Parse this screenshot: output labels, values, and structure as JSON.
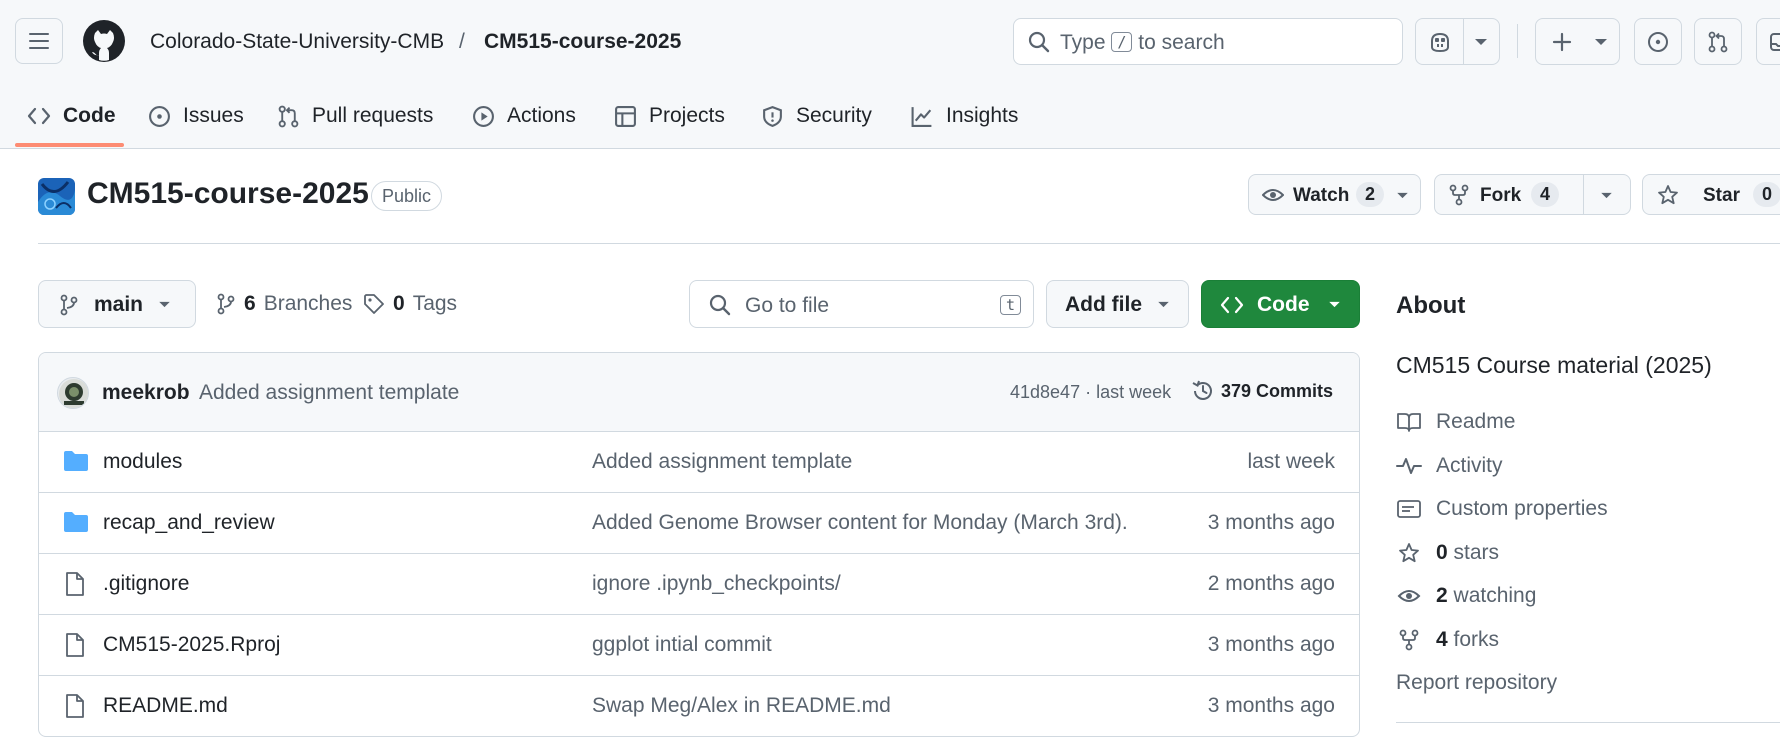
{
  "header": {
    "org": "Colorado-State-University-CMB",
    "separator": "/",
    "repo": "CM515-course-2025",
    "search": {
      "prefix": "Type",
      "key": "/",
      "suffix": "to search"
    }
  },
  "tabs": [
    {
      "label": "Code",
      "icon": "code-icon",
      "selected": true
    },
    {
      "label": "Issues",
      "icon": "issue-opened-icon"
    },
    {
      "label": "Pull requests",
      "icon": "git-pull-request-icon"
    },
    {
      "label": "Actions",
      "icon": "play-icon"
    },
    {
      "label": "Projects",
      "icon": "table-icon"
    },
    {
      "label": "Security",
      "icon": "shield-icon"
    },
    {
      "label": "Insights",
      "icon": "graph-icon"
    }
  ],
  "repo": {
    "title": "CM515-course-2025",
    "visibility": "Public",
    "watch": {
      "label": "Watch",
      "count": "2"
    },
    "fork": {
      "label": "Fork",
      "count": "4"
    },
    "star": {
      "label": "Star",
      "count": "0"
    }
  },
  "toolbar": {
    "branch": "main",
    "branches": {
      "count": "6",
      "label": "Branches"
    },
    "tags": {
      "count": "0",
      "label": "Tags"
    },
    "goto_placeholder": "Go to file",
    "goto_key": "t",
    "add_file": "Add file",
    "code": "Code"
  },
  "latest_commit": {
    "author": "meekrob",
    "message": "Added assignment template",
    "sha_time": "41d8e47 · last week",
    "commits": "379 Commits"
  },
  "files": [
    {
      "name": "modules",
      "type": "folder",
      "message": "Added assignment template",
      "age": "last week"
    },
    {
      "name": "recap_and_review",
      "type": "folder",
      "message": "Added Genome Browser content for Monday (March 3rd).",
      "age": "3 months ago"
    },
    {
      "name": ".gitignore",
      "type": "file",
      "message": "ignore .ipynb_checkpoints/",
      "age": "2 months ago"
    },
    {
      "name": "CM515-2025.Rproj",
      "type": "file",
      "message": "ggplot intial commit",
      "age": "3 months ago"
    },
    {
      "name": "README.md",
      "type": "file",
      "message": "Swap Meg/Alex in README.md",
      "age": "3 months ago"
    }
  ],
  "about": {
    "heading": "About",
    "description": "CM515 Course material (2025)",
    "readme": "Readme",
    "activity": "Activity",
    "custom_properties": "Custom properties",
    "stars": {
      "count": "0",
      "label": "stars"
    },
    "watching": {
      "count": "2",
      "label": "watching"
    },
    "forks": {
      "count": "4",
      "label": "forks"
    },
    "report": "Report repository"
  },
  "colors": {
    "accent_tab": "#fd8c73",
    "primary_green": "#1f883d",
    "folder_blue": "#54aeff",
    "muted_text": "#59636e",
    "border": "#d1d9e0"
  }
}
